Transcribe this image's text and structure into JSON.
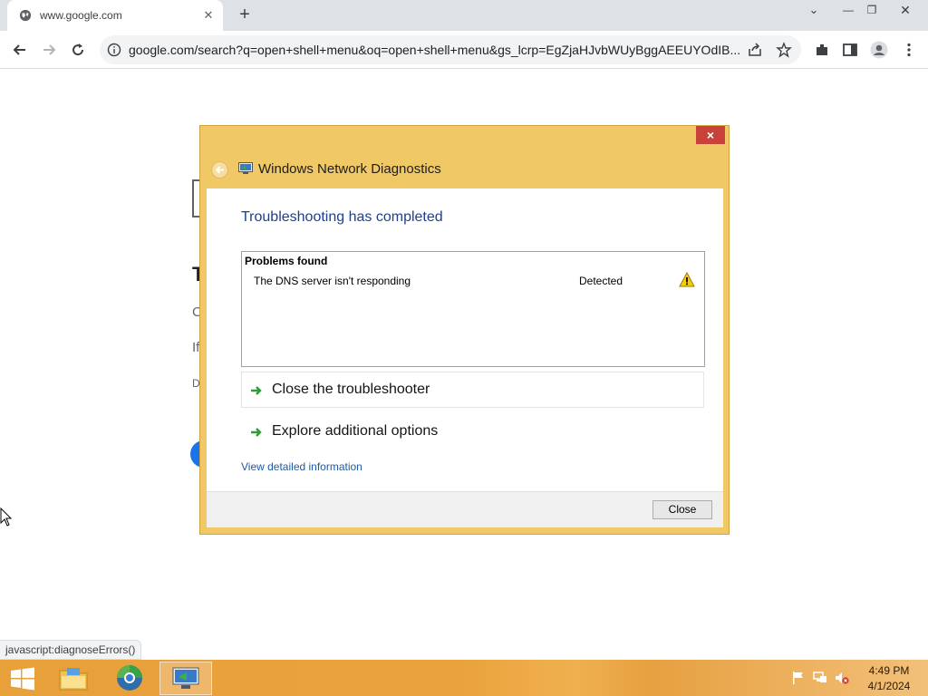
{
  "browser": {
    "tab": {
      "title": "www.google.com"
    },
    "address": {
      "url": "google.com/search?q=open+shell+menu&oq=open+shell+menu&gs_lcrp=EgZjaHJvbWUyBggAEEUYOdIB..."
    },
    "status_text": "javascript:diagnoseErrors()"
  },
  "background_page": {
    "fragments": [
      "T",
      "C",
      "If",
      "D"
    ]
  },
  "dialog": {
    "title": "Windows Network Diagnostics",
    "heading": "Troubleshooting has completed",
    "problems_header": "Problems found",
    "problems": [
      {
        "description": "The DNS server isn't responding",
        "status": "Detected",
        "icon": "warning-icon"
      }
    ],
    "commands": [
      {
        "label": "Close the troubleshooter",
        "icon": "green-arrow-icon"
      },
      {
        "label": "Explore additional options",
        "icon": "green-arrow-icon"
      }
    ],
    "detail_link": "View detailed information",
    "close_button": "Close",
    "title_close": "×"
  },
  "taskbar": {
    "time": "4:49 PM",
    "date": "4/1/2024",
    "pinned": [
      "start-icon",
      "file-explorer-icon",
      "chrome-icon",
      "network-diagnostics-icon"
    ],
    "tray": [
      "flag-icon",
      "network-error-icon",
      "speaker-muted-icon"
    ]
  },
  "colors": {
    "dialog_frame": "#f0c866",
    "heading_blue": "#1e3f8c",
    "link_blue": "#1e5aa8",
    "close_red": "#c7433a"
  }
}
